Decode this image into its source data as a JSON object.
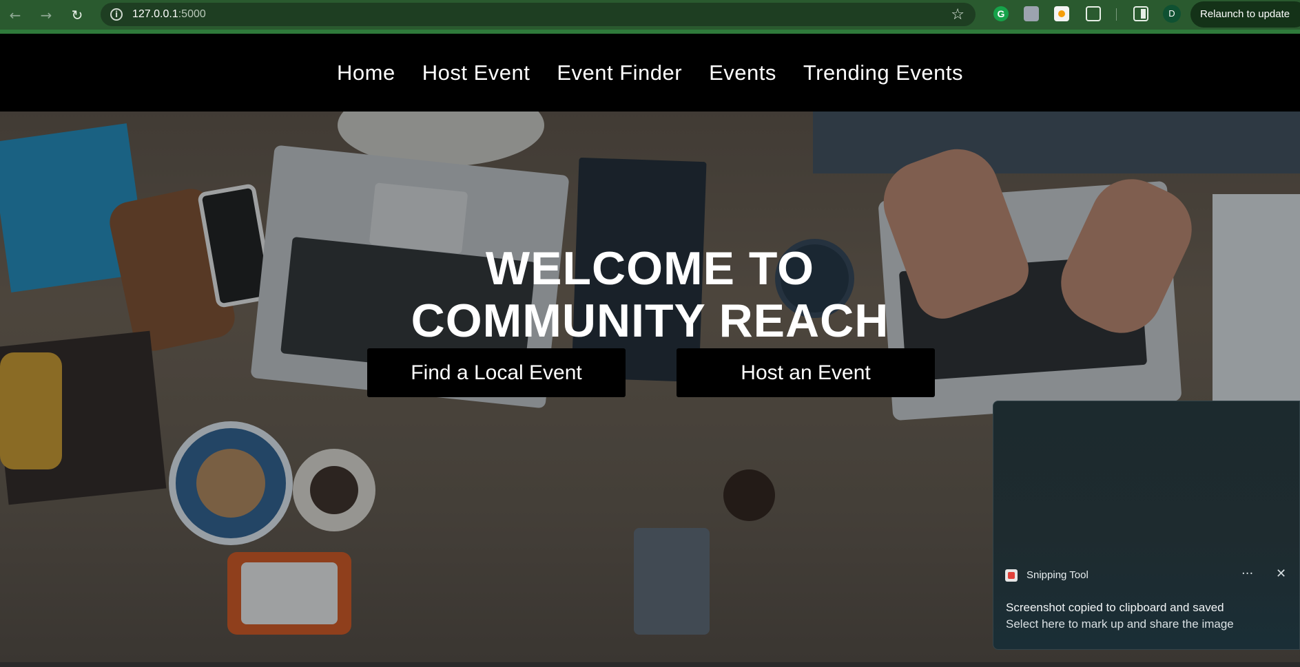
{
  "browser": {
    "back_icon": "arrow-left-icon",
    "forward_icon": "arrow-right-icon",
    "reload_icon": "reload-icon",
    "url_host": "127.0.0.1",
    "url_port": ":5000",
    "bookmark_icon": "star-icon",
    "profile_initial": "D",
    "relaunch_label": "Relaunch to update"
  },
  "nav": {
    "items": [
      "Home",
      "Host Event",
      "Event Finder",
      "Events",
      "Trending Events"
    ]
  },
  "hero": {
    "title_line1": "WELCOME TO",
    "title_line2": "COMMUNITY REACH",
    "find_button": "Find a Local Event",
    "host_button": "Host an Event"
  },
  "toast": {
    "app_name": "Snipping Tool",
    "more_label": "···",
    "close_label": "✕",
    "title": "Screenshot copied to clipboard and saved",
    "body": "Select here to mark up and share the image"
  },
  "colors": {
    "chrome_bg": "#2a5a2f",
    "nav_bg": "#000000",
    "button_bg": "#000000",
    "hero_text": "#ffffff"
  }
}
